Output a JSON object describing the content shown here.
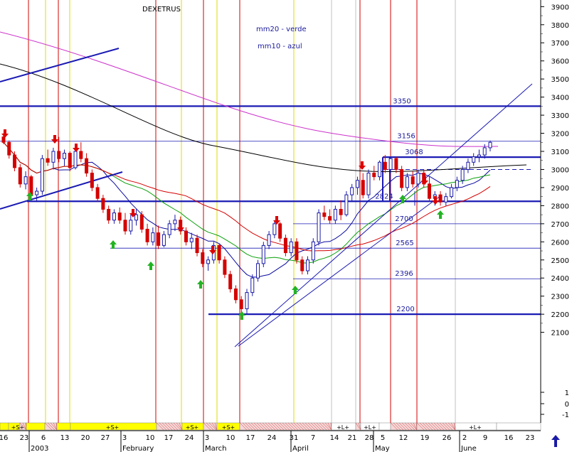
{
  "chart_data": {
    "type": "candlestick",
    "title": "DEXETRUS",
    "ylim": [
      -1,
      4000
    ],
    "y_ticks": [
      3900,
      3800,
      3700,
      3600,
      3500,
      3400,
      3300,
      3200,
      3100,
      3000,
      2900,
      2800,
      2700,
      2600,
      2500,
      2400,
      2300,
      2200,
      2100,
      1,
      0,
      -1
    ],
    "grid": false,
    "x_day_labels": [
      "16",
      "23",
      "6",
      "13",
      "20",
      "27",
      "3",
      "10",
      "17",
      "24",
      "3",
      "10",
      "17",
      "24",
      "31",
      "7",
      "14",
      "21",
      "28",
      "5",
      "12",
      "19",
      "26",
      "2",
      "9",
      "16",
      "23"
    ],
    "x_month_labels": [
      "2003",
      "February",
      "March",
      "April",
      "May",
      "June"
    ],
    "legend": [
      "mm20 - verde",
      "mm10 - azul"
    ],
    "levels": [
      {
        "value": 3350,
        "label": "3350"
      },
      {
        "value": 3156,
        "label": "3156"
      },
      {
        "value": 3068,
        "label": "3068"
      },
      {
        "value": 2824,
        "label": "2824"
      },
      {
        "value": 2700,
        "label": "2700"
      },
      {
        "value": 2565,
        "label": "2565"
      },
      {
        "value": 2396,
        "label": "2396"
      },
      {
        "value": 2200,
        "label": "2200"
      }
    ],
    "band_labels": [
      "+S+",
      "+S+",
      "+S+",
      "+S+",
      "+L+",
      "+L+",
      "+L+"
    ],
    "colors": {
      "up": "#1a1aa8",
      "down": "#d40000",
      "mm10": "#0a0aa0",
      "mm20": "#0aa00a",
      "ma_red": "#d40000",
      "ma_black": "#000000",
      "ma_magenta": "#cc33cc",
      "level": "#1a1ab4",
      "signal_buy": "#22b422",
      "signal_sell": "#dd0000",
      "band_yellow": "#ffff00"
    },
    "candles": [
      [
        3180,
        3200,
        3140,
        3150
      ],
      [
        3150,
        3160,
        3060,
        3080
      ],
      [
        3080,
        3100,
        2990,
        3010
      ],
      [
        3010,
        3030,
        2900,
        2920
      ],
      [
        2920,
        2990,
        2890,
        2960
      ],
      [
        2960,
        2970,
        2840,
        2860
      ],
      [
        2860,
        2900,
        2820,
        2880
      ],
      [
        2880,
        3080,
        2860,
        3060
      ],
      [
        3060,
        3110,
        3020,
        3040
      ],
      [
        3040,
        3120,
        3000,
        3100
      ],
      [
        3100,
        3180,
        3040,
        3060
      ],
      [
        3060,
        3110,
        3020,
        3090
      ],
      [
        3090,
        3100,
        2990,
        3010
      ],
      [
        3010,
        3120,
        3000,
        3100
      ],
      [
        3100,
        3150,
        3040,
        3060
      ],
      [
        3060,
        3090,
        2960,
        2980
      ],
      [
        2980,
        3000,
        2880,
        2900
      ],
      [
        2900,
        2920,
        2820,
        2840
      ],
      [
        2840,
        2860,
        2760,
        2780
      ],
      [
        2780,
        2800,
        2700,
        2720
      ],
      [
        2720,
        2780,
        2700,
        2760
      ],
      [
        2760,
        2790,
        2700,
        2720
      ],
      [
        2720,
        2760,
        2640,
        2660
      ],
      [
        2660,
        2750,
        2640,
        2720
      ],
      [
        2720,
        2780,
        2690,
        2750
      ],
      [
        2750,
        2770,
        2650,
        2670
      ],
      [
        2670,
        2700,
        2580,
        2600
      ],
      [
        2600,
        2680,
        2580,
        2650
      ],
      [
        2650,
        2690,
        2560,
        2580
      ],
      [
        2580,
        2660,
        2570,
        2640
      ],
      [
        2640,
        2720,
        2620,
        2700
      ],
      [
        2700,
        2750,
        2660,
        2720
      ],
      [
        2720,
        2740,
        2640,
        2660
      ],
      [
        2660,
        2680,
        2580,
        2600
      ],
      [
        2600,
        2650,
        2560,
        2620
      ],
      [
        2620,
        2640,
        2520,
        2540
      ],
      [
        2540,
        2560,
        2460,
        2480
      ],
      [
        2480,
        2520,
        2440,
        2500
      ],
      [
        2500,
        2600,
        2480,
        2580
      ],
      [
        2580,
        2590,
        2480,
        2500
      ],
      [
        2500,
        2520,
        2400,
        2420
      ],
      [
        2420,
        2440,
        2320,
        2340
      ],
      [
        2340,
        2360,
        2260,
        2280
      ],
      [
        2280,
        2300,
        2210,
        2230
      ],
      [
        2230,
        2340,
        2200,
        2320
      ],
      [
        2320,
        2420,
        2300,
        2400
      ],
      [
        2400,
        2500,
        2380,
        2480
      ],
      [
        2480,
        2600,
        2460,
        2580
      ],
      [
        2580,
        2660,
        2560,
        2640
      ],
      [
        2640,
        2720,
        2620,
        2700
      ],
      [
        2700,
        2710,
        2600,
        2620
      ],
      [
        2620,
        2640,
        2520,
        2540
      ],
      [
        2540,
        2620,
        2520,
        2600
      ],
      [
        2600,
        2620,
        2480,
        2500
      ],
      [
        2500,
        2520,
        2420,
        2440
      ],
      [
        2440,
        2520,
        2420,
        2500
      ],
      [
        2500,
        2620,
        2480,
        2600
      ],
      [
        2600,
        2780,
        2580,
        2760
      ],
      [
        2760,
        2800,
        2720,
        2740
      ],
      [
        2740,
        2780,
        2700,
        2720
      ],
      [
        2720,
        2800,
        2700,
        2780
      ],
      [
        2780,
        2830,
        2720,
        2750
      ],
      [
        2750,
        2880,
        2740,
        2860
      ],
      [
        2860,
        2920,
        2820,
        2900
      ],
      [
        2900,
        2960,
        2860,
        2940
      ],
      [
        2940,
        2980,
        2840,
        2860
      ],
      [
        2860,
        3000,
        2840,
        2980
      ],
      [
        2980,
        3020,
        2940,
        2960
      ],
      [
        2960,
        3050,
        2940,
        3040
      ],
      [
        3040,
        3080,
        2980,
        3000
      ],
      [
        3000,
        3070,
        2980,
        3060
      ],
      [
        3060,
        3070,
        2980,
        3000
      ],
      [
        3000,
        3020,
        2880,
        2900
      ],
      [
        2900,
        2980,
        2880,
        2960
      ],
      [
        2960,
        2990,
        2900,
        2920
      ],
      [
        2920,
        3000,
        2900,
        2980
      ],
      [
        2980,
        3000,
        2900,
        2920
      ],
      [
        2920,
        2960,
        2820,
        2840
      ],
      [
        2840,
        2880,
        2800,
        2860
      ],
      [
        2860,
        2880,
        2800,
        2820
      ],
      [
        2820,
        2870,
        2800,
        2850
      ],
      [
        2850,
        2920,
        2840,
        2900
      ],
      [
        2900,
        2960,
        2880,
        2940
      ],
      [
        2940,
        3020,
        2920,
        3000
      ],
      [
        3000,
        3060,
        2980,
        3040
      ],
      [
        3040,
        3090,
        3020,
        3070
      ],
      [
        3070,
        3110,
        3040,
        3080
      ],
      [
        3080,
        3140,
        3060,
        3120
      ],
      [
        3120,
        3160,
        3100,
        3150
      ]
    ]
  }
}
